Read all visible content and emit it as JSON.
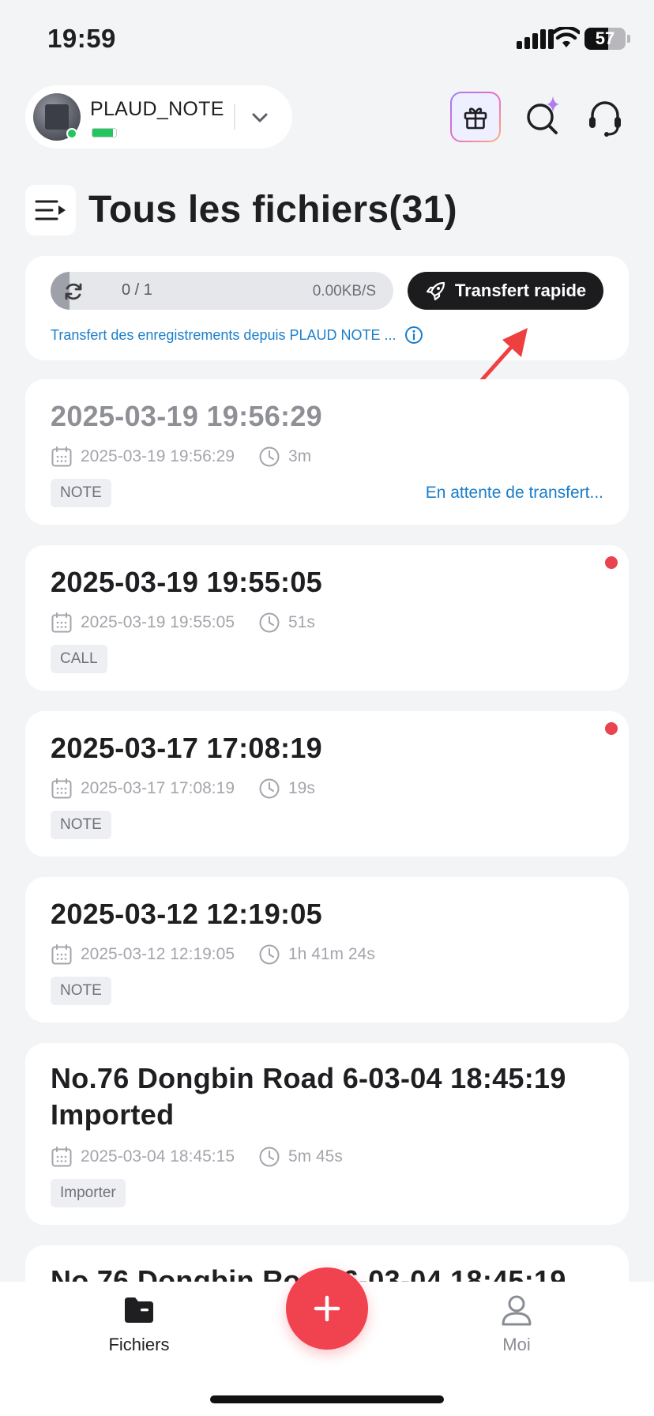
{
  "status_bar": {
    "time": "19:59",
    "battery": "57",
    "battery_level": 0.57
  },
  "device": {
    "name": "PLAUD_NOTE",
    "battery_level": 0.85
  },
  "header_icons": {
    "gift": "gift-icon",
    "ai_search": "ai-search-icon",
    "support": "headset-icon"
  },
  "page": {
    "title": "Tous les fichiers(31)"
  },
  "transfer": {
    "progress": "0 / 1",
    "progress_fraction": 0,
    "speed": "0.00KB/S",
    "button_label": "Transfert rapide",
    "info": "Transfert des enregistrements depuis PLAUD NOTE ..."
  },
  "files": [
    {
      "title": "2025-03-19 19:56:29",
      "date": "2025-03-19 19:56:29",
      "duration": "3m",
      "tag": "NOTE",
      "status": "En attente de transfert..."
    },
    {
      "title": "2025-03-19 19:55:05",
      "date": "2025-03-19 19:55:05",
      "duration": "51s",
      "tag": "CALL"
    },
    {
      "title": "2025-03-17 17:08:19",
      "date": "2025-03-17 17:08:19",
      "duration": "19s",
      "tag": "NOTE"
    },
    {
      "title": "2025-03-12 12:19:05",
      "date": "2025-03-12 12:19:05",
      "duration": "1h 41m 24s",
      "tag": "NOTE"
    },
    {
      "title_line1": "No.76 Dongbin Road 6-03-04 18:45:19",
      "title_line2": "Imported",
      "date": "2025-03-04 18:45:15",
      "duration": "5m 45s",
      "tag": "Importer"
    },
    {
      "title": "No.76 Dongbin Road 6-03-04 18:45:19"
    }
  ],
  "nav": {
    "files": "Fichiers",
    "me": "Moi"
  },
  "colors": {
    "accent_blue": "#1a7ecb",
    "fab_red": "#f0424f",
    "unread_red": "#e8434f",
    "online_green": "#22c55e"
  }
}
